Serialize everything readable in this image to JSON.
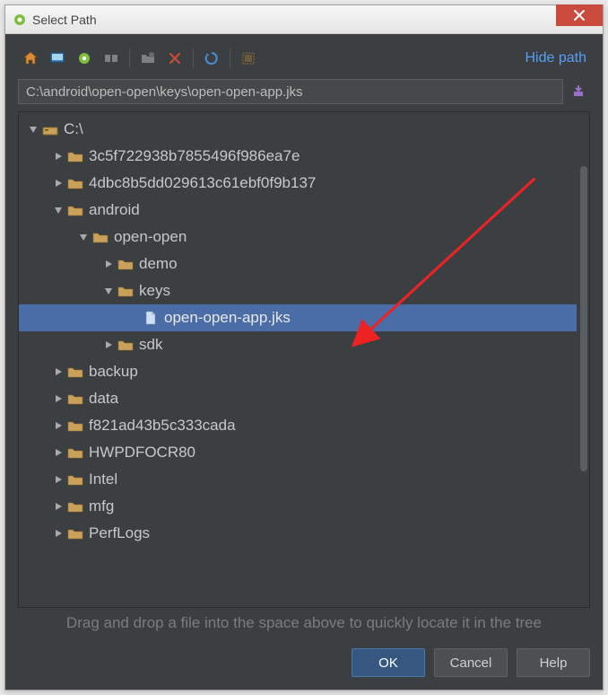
{
  "window": {
    "title": "Select Path"
  },
  "toolbar": {
    "hide_path": "Hide path"
  },
  "path": {
    "value": "C:\\android\\open-open\\keys\\open-open-app.jks"
  },
  "tree": {
    "root": {
      "label": "C:\\",
      "expanded": true,
      "type": "drive"
    },
    "items": [
      {
        "level": 1,
        "expanded": null,
        "type": "folder",
        "label": "3c5f722938b7855496f986ea7e"
      },
      {
        "level": 1,
        "expanded": null,
        "type": "folder",
        "label": "4dbc8b5dd029613c61ebf0f9b137"
      },
      {
        "level": 1,
        "expanded": true,
        "type": "folder",
        "label": "android"
      },
      {
        "level": 2,
        "expanded": true,
        "type": "folder",
        "label": "open-open"
      },
      {
        "level": 3,
        "expanded": null,
        "type": "folder",
        "label": "demo"
      },
      {
        "level": 3,
        "expanded": true,
        "type": "folder",
        "label": "keys"
      },
      {
        "level": 4,
        "expanded": null,
        "type": "file",
        "label": "open-open-app.jks",
        "selected": true
      },
      {
        "level": 3,
        "expanded": null,
        "type": "folder",
        "label": "sdk"
      },
      {
        "level": 1,
        "expanded": null,
        "type": "folder",
        "label": "backup"
      },
      {
        "level": 1,
        "expanded": null,
        "type": "folder",
        "label": "data"
      },
      {
        "level": 1,
        "expanded": null,
        "type": "folder",
        "label": "f821ad43b5c333cada"
      },
      {
        "level": 1,
        "expanded": null,
        "type": "folder",
        "label": "HWPDFOCR80"
      },
      {
        "level": 1,
        "expanded": null,
        "type": "folder",
        "label": "Intel"
      },
      {
        "level": 1,
        "expanded": null,
        "type": "folder",
        "label": "mfg"
      },
      {
        "level": 1,
        "expanded": null,
        "type": "folder",
        "label": "PerfLogs"
      }
    ]
  },
  "hint": "Drag and drop a file into the space above to quickly locate it in the tree",
  "buttons": {
    "ok": "OK",
    "cancel": "Cancel",
    "help": "Help"
  }
}
